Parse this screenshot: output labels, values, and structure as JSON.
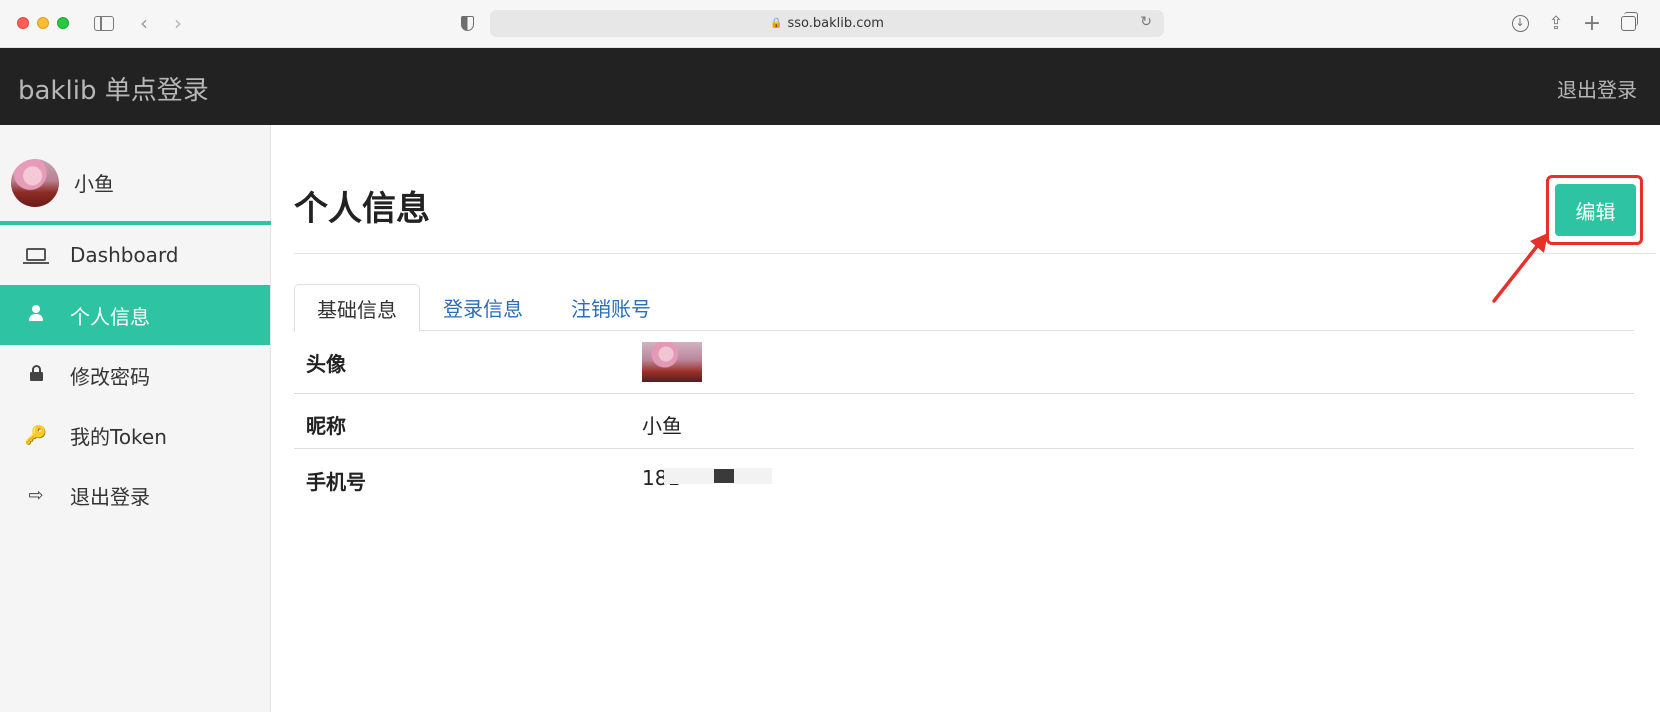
{
  "browser": {
    "url": "sso.baklib.com",
    "lock_glyph": "🔒",
    "reload_glyph": "↻",
    "back_glyph": "‹",
    "forward_glyph": "›",
    "download_glyph": "↓",
    "share_glyph": "⇪",
    "new_tab_glyph": "+"
  },
  "topnav": {
    "brand": "baklib 单点登录",
    "logout": "退出登录"
  },
  "sidebar": {
    "user_name": "小鱼",
    "items": [
      {
        "label": "Dashboard",
        "icon": "laptop-icon"
      },
      {
        "label": "个人信息",
        "icon": "user-icon",
        "active": true
      },
      {
        "label": "修改密码",
        "icon": "lock-icon"
      },
      {
        "label": "我的Token",
        "icon": "key-icon",
        "glyph": "🔑"
      },
      {
        "label": "退出登录",
        "icon": "sign-out-icon",
        "glyph": "⇨"
      }
    ],
    "accent_color": "#2ec4a3"
  },
  "main": {
    "title": "个人信息",
    "edit_button": "编辑",
    "tabs": [
      {
        "label": "基础信息",
        "active": true
      },
      {
        "label": "登录信息"
      },
      {
        "label": "注销账号"
      }
    ],
    "fields": {
      "avatar_label": "头像",
      "nickname_label": "昵称",
      "nickname_value": "小鱼",
      "phone_label": "手机号",
      "phone_value": "181"
    }
  },
  "colors": {
    "primary": "#2ec4a3",
    "navbar": "#222222",
    "link": "#2a6db8",
    "annotation": "#e8302a"
  }
}
